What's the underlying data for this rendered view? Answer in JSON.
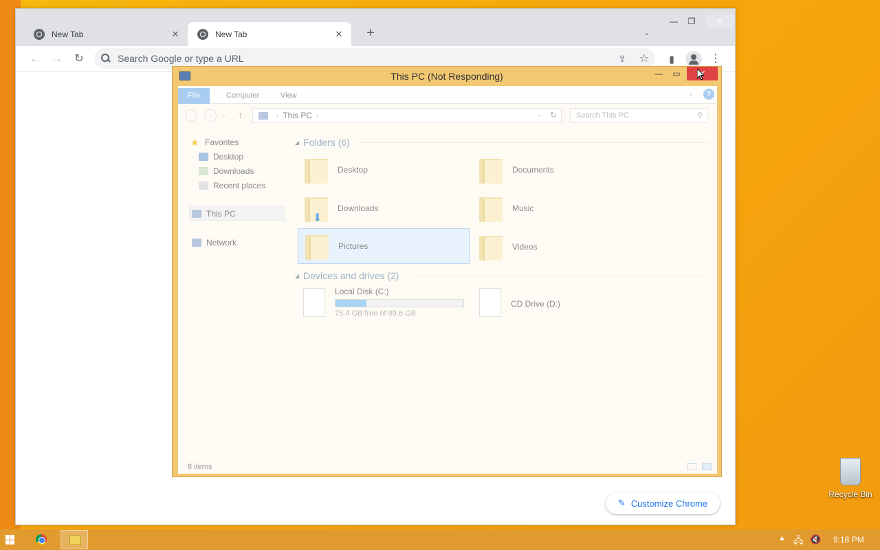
{
  "chrome": {
    "tabs": [
      {
        "title": "New Tab"
      },
      {
        "title": "New Tab"
      }
    ],
    "omnibox_placeholder": "Search Google or type a URL",
    "customize_label": "Customize Chrome"
  },
  "explorer": {
    "title": "This PC (Not Responding)",
    "ribbon_tabs": [
      "File",
      "Computer",
      "View"
    ],
    "address": "This PC",
    "search_placeholder": "Search This PC",
    "nav": {
      "favorites": "Favorites",
      "desktop": "Desktop",
      "downloads": "Downloads",
      "recent": "Recent places",
      "this_pc": "This PC",
      "network": "Network"
    },
    "folders_header": "Folders (6)",
    "folders": [
      "Desktop",
      "Documents",
      "Downloads",
      "Music",
      "Pictures",
      "Videos"
    ],
    "drives_header": "Devices and drives (2)",
    "drives": [
      {
        "name": "Local Disk (C:)",
        "free_text": "75.4 GB free of 99.6 GB",
        "used_fraction": 0.243
      },
      {
        "name": "CD Drive (D:)"
      }
    ],
    "status": "8 items"
  },
  "desktop": {
    "recycle_bin": "Recycle Bin"
  },
  "taskbar": {
    "clock": "9:18 PM"
  },
  "colors": {
    "desktop_bg": "#f6b80e",
    "explorer_frame": "#f3c873",
    "close_button": "#e04343",
    "chrome_link": "#1a73e8"
  }
}
